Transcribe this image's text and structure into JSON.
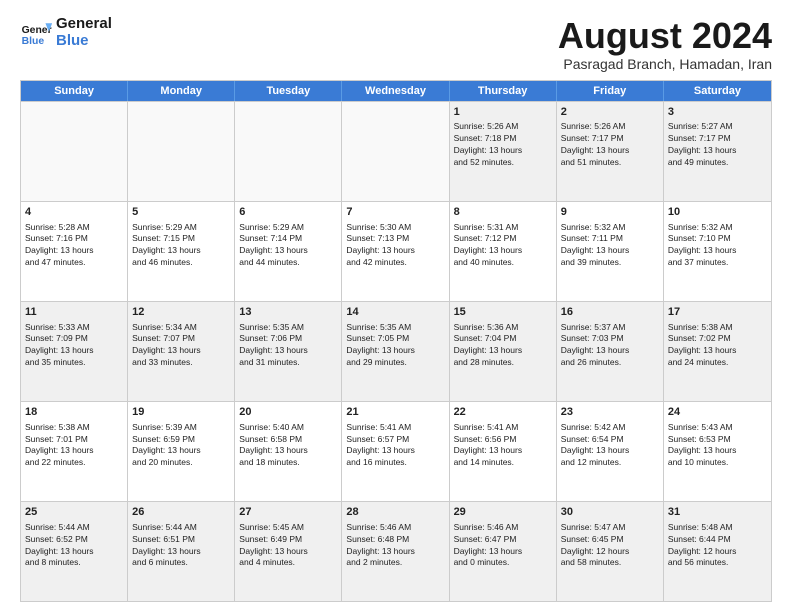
{
  "logo": {
    "line1": "General",
    "line2": "Blue"
  },
  "title": "August 2024",
  "subtitle": "Pasragad Branch, Hamadan, Iran",
  "headers": [
    "Sunday",
    "Monday",
    "Tuesday",
    "Wednesday",
    "Thursday",
    "Friday",
    "Saturday"
  ],
  "weeks": [
    [
      {
        "day": "",
        "empty": true
      },
      {
        "day": "",
        "empty": true
      },
      {
        "day": "",
        "empty": true
      },
      {
        "day": "",
        "empty": true
      },
      {
        "day": "1",
        "lines": [
          "Sunrise: 5:26 AM",
          "Sunset: 7:18 PM",
          "Daylight: 13 hours",
          "and 52 minutes."
        ]
      },
      {
        "day": "2",
        "lines": [
          "Sunrise: 5:26 AM",
          "Sunset: 7:17 PM",
          "Daylight: 13 hours",
          "and 51 minutes."
        ]
      },
      {
        "day": "3",
        "lines": [
          "Sunrise: 5:27 AM",
          "Sunset: 7:17 PM",
          "Daylight: 13 hours",
          "and 49 minutes."
        ]
      }
    ],
    [
      {
        "day": "4",
        "lines": [
          "Sunrise: 5:28 AM",
          "Sunset: 7:16 PM",
          "Daylight: 13 hours",
          "and 47 minutes."
        ]
      },
      {
        "day": "5",
        "lines": [
          "Sunrise: 5:29 AM",
          "Sunset: 7:15 PM",
          "Daylight: 13 hours",
          "and 46 minutes."
        ]
      },
      {
        "day": "6",
        "lines": [
          "Sunrise: 5:29 AM",
          "Sunset: 7:14 PM",
          "Daylight: 13 hours",
          "and 44 minutes."
        ]
      },
      {
        "day": "7",
        "lines": [
          "Sunrise: 5:30 AM",
          "Sunset: 7:13 PM",
          "Daylight: 13 hours",
          "and 42 minutes."
        ]
      },
      {
        "day": "8",
        "lines": [
          "Sunrise: 5:31 AM",
          "Sunset: 7:12 PM",
          "Daylight: 13 hours",
          "and 40 minutes."
        ]
      },
      {
        "day": "9",
        "lines": [
          "Sunrise: 5:32 AM",
          "Sunset: 7:11 PM",
          "Daylight: 13 hours",
          "and 39 minutes."
        ]
      },
      {
        "day": "10",
        "lines": [
          "Sunrise: 5:32 AM",
          "Sunset: 7:10 PM",
          "Daylight: 13 hours",
          "and 37 minutes."
        ]
      }
    ],
    [
      {
        "day": "11",
        "lines": [
          "Sunrise: 5:33 AM",
          "Sunset: 7:09 PM",
          "Daylight: 13 hours",
          "and 35 minutes."
        ]
      },
      {
        "day": "12",
        "lines": [
          "Sunrise: 5:34 AM",
          "Sunset: 7:07 PM",
          "Daylight: 13 hours",
          "and 33 minutes."
        ]
      },
      {
        "day": "13",
        "lines": [
          "Sunrise: 5:35 AM",
          "Sunset: 7:06 PM",
          "Daylight: 13 hours",
          "and 31 minutes."
        ]
      },
      {
        "day": "14",
        "lines": [
          "Sunrise: 5:35 AM",
          "Sunset: 7:05 PM",
          "Daylight: 13 hours",
          "and 29 minutes."
        ]
      },
      {
        "day": "15",
        "lines": [
          "Sunrise: 5:36 AM",
          "Sunset: 7:04 PM",
          "Daylight: 13 hours",
          "and 28 minutes."
        ]
      },
      {
        "day": "16",
        "lines": [
          "Sunrise: 5:37 AM",
          "Sunset: 7:03 PM",
          "Daylight: 13 hours",
          "and 26 minutes."
        ]
      },
      {
        "day": "17",
        "lines": [
          "Sunrise: 5:38 AM",
          "Sunset: 7:02 PM",
          "Daylight: 13 hours",
          "and 24 minutes."
        ]
      }
    ],
    [
      {
        "day": "18",
        "lines": [
          "Sunrise: 5:38 AM",
          "Sunset: 7:01 PM",
          "Daylight: 13 hours",
          "and 22 minutes."
        ]
      },
      {
        "day": "19",
        "lines": [
          "Sunrise: 5:39 AM",
          "Sunset: 6:59 PM",
          "Daylight: 13 hours",
          "and 20 minutes."
        ]
      },
      {
        "day": "20",
        "lines": [
          "Sunrise: 5:40 AM",
          "Sunset: 6:58 PM",
          "Daylight: 13 hours",
          "and 18 minutes."
        ]
      },
      {
        "day": "21",
        "lines": [
          "Sunrise: 5:41 AM",
          "Sunset: 6:57 PM",
          "Daylight: 13 hours",
          "and 16 minutes."
        ]
      },
      {
        "day": "22",
        "lines": [
          "Sunrise: 5:41 AM",
          "Sunset: 6:56 PM",
          "Daylight: 13 hours",
          "and 14 minutes."
        ]
      },
      {
        "day": "23",
        "lines": [
          "Sunrise: 5:42 AM",
          "Sunset: 6:54 PM",
          "Daylight: 13 hours",
          "and 12 minutes."
        ]
      },
      {
        "day": "24",
        "lines": [
          "Sunrise: 5:43 AM",
          "Sunset: 6:53 PM",
          "Daylight: 13 hours",
          "and 10 minutes."
        ]
      }
    ],
    [
      {
        "day": "25",
        "lines": [
          "Sunrise: 5:44 AM",
          "Sunset: 6:52 PM",
          "Daylight: 13 hours",
          "and 8 minutes."
        ]
      },
      {
        "day": "26",
        "lines": [
          "Sunrise: 5:44 AM",
          "Sunset: 6:51 PM",
          "Daylight: 13 hours",
          "and 6 minutes."
        ]
      },
      {
        "day": "27",
        "lines": [
          "Sunrise: 5:45 AM",
          "Sunset: 6:49 PM",
          "Daylight: 13 hours",
          "and 4 minutes."
        ]
      },
      {
        "day": "28",
        "lines": [
          "Sunrise: 5:46 AM",
          "Sunset: 6:48 PM",
          "Daylight: 13 hours",
          "and 2 minutes."
        ]
      },
      {
        "day": "29",
        "lines": [
          "Sunrise: 5:46 AM",
          "Sunset: 6:47 PM",
          "Daylight: 13 hours",
          "and 0 minutes."
        ]
      },
      {
        "day": "30",
        "lines": [
          "Sunrise: 5:47 AM",
          "Sunset: 6:45 PM",
          "Daylight: 12 hours",
          "and 58 minutes."
        ]
      },
      {
        "day": "31",
        "lines": [
          "Sunrise: 5:48 AM",
          "Sunset: 6:44 PM",
          "Daylight: 12 hours",
          "and 56 minutes."
        ]
      }
    ]
  ]
}
